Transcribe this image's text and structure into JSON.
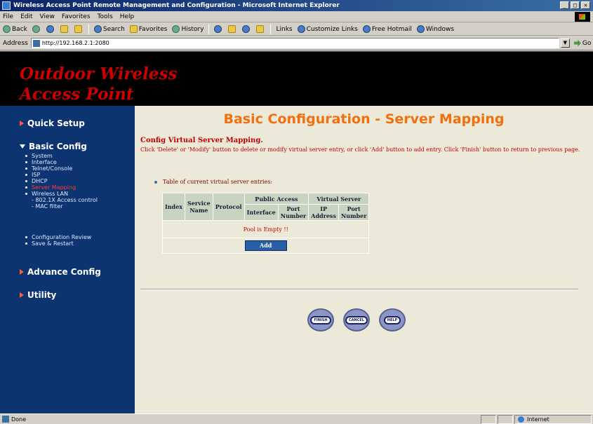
{
  "window": {
    "title": "Wireless Access Point Remote Management and Configuration - Microsoft Internet Explorer",
    "controls": [
      "_",
      "□",
      "×"
    ]
  },
  "menu": [
    "File",
    "Edit",
    "View",
    "Favorites",
    "Tools",
    "Help"
  ],
  "toolbar": {
    "back": "Back",
    "search": "Search",
    "favorites": "Favorites",
    "history": "History",
    "links": "Links",
    "customize": "Customize Links",
    "hotmail": "Free Hotmail",
    "windows": "Windows"
  },
  "address": {
    "label": "Address",
    "url": "http://192.168.2.1:2080",
    "go": "Go"
  },
  "banner": {
    "line1": "Outdoor Wireless",
    "line2": "Access Point"
  },
  "sidebar": {
    "quick_setup": "Quick Setup",
    "basic_config": "Basic Config",
    "basic_items": [
      "System",
      "Interface",
      "Telnet/Console",
      "ISP",
      "DHCP",
      "Server Mapping",
      "Wireless LAN"
    ],
    "wlan_sub": [
      "- 802.1X Access control",
      "- MAC filter"
    ],
    "basic_items2": [
      "Configuration Review",
      "Save & Restart"
    ],
    "advance_config": "Advance Config",
    "utility": "Utility"
  },
  "main": {
    "title": "Basic Configuration - Server Mapping",
    "cfg_title": "Config Virtual Server Mapping.",
    "cfg_desc": "Click 'Delete' or 'Modify' button to delete or modify virtual server entry, or click 'Add' button to add entry. Click 'Finish' button to return to previous page.",
    "bullet": "Table of current virtual server entries:",
    "table": {
      "index": "Index",
      "service_name": "Service Name",
      "protocol": "Protocol",
      "public_access": "Public Access",
      "virtual_server": "Virtual Server",
      "interface": "Interface",
      "port_number": "Port Number",
      "ip_address": "IP Address",
      "port_number2": "Port Number",
      "empty": "Pool is Empty !!",
      "add": "Add"
    },
    "buttons": {
      "finish": "FINISH",
      "cancel": "CANCEL",
      "help": "HELP"
    }
  },
  "status": {
    "done": "Done",
    "zone": "Internet"
  },
  "colors": {
    "banner_text": "#cc0000",
    "sidebar_bg": "#0c3470",
    "title_orange": "#f07010",
    "main_bg": "#ece9d8"
  }
}
